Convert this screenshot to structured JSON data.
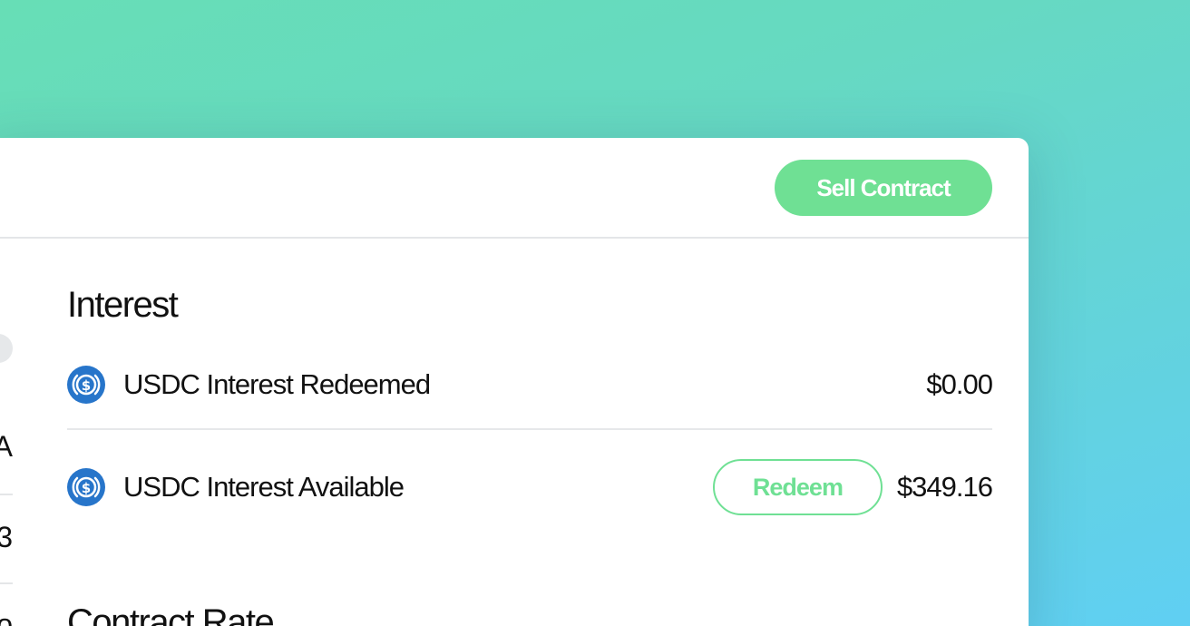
{
  "header": {
    "sell_contract_label": "Sell Contract"
  },
  "left_column_fragments": {
    "row1_text": "A",
    "row2_text": "3",
    "row3_text": "o"
  },
  "interest": {
    "title": "Interest",
    "rows": [
      {
        "icon": "usdc-icon",
        "label": "USDC Interest Redeemed",
        "value": "$0.00"
      },
      {
        "icon": "usdc-icon",
        "label": "USDC Interest Available",
        "action_label": "Redeem",
        "value": "$349.16"
      }
    ]
  },
  "contract_rate": {
    "title": "Contract Rate"
  },
  "colors": {
    "accent_green": "#6fe094",
    "usdc_blue": "#2775ca",
    "background_gradient_start": "#67deb6",
    "background_gradient_end": "#60cff3"
  }
}
